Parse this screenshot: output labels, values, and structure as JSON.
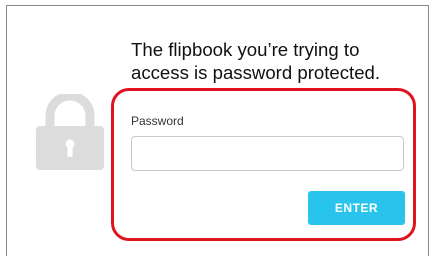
{
  "dialog": {
    "heading": "The flipbook you’re trying to access is password protected.",
    "lock_icon": "lock-icon"
  },
  "form": {
    "password_label": "Password",
    "password_value": "",
    "password_placeholder": "",
    "enter_label": "ENTER"
  },
  "colors": {
    "button": "#29c4ec",
    "highlight": "#e0141e",
    "lock": "#dcdcdc"
  }
}
